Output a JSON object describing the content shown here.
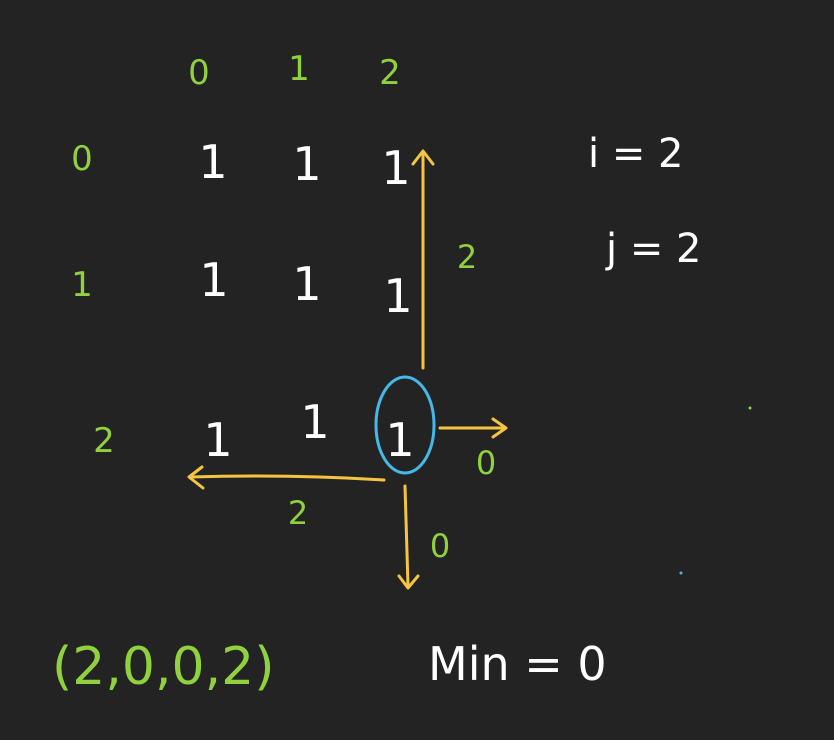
{
  "colors": {
    "background": "#232323",
    "green": "#8fd13f",
    "white": "#ffffff",
    "yellow": "#f5c542",
    "blue": "#45b8e8"
  },
  "column_indices": [
    "0",
    "1",
    "2"
  ],
  "row_indices": [
    "0",
    "1",
    "2"
  ],
  "grid_values": [
    [
      "1",
      "1",
      "1"
    ],
    [
      "1",
      "1",
      "1"
    ],
    [
      "1",
      "1",
      "1"
    ]
  ],
  "labels": {
    "up_distance": "2",
    "right_distance": "0",
    "down_distance": "0",
    "left_distance": "2",
    "i_equation": "i = 2",
    "j_equation": "j = 2",
    "tuple": "(2,0,0,2)",
    "min_label": "Min = 0"
  }
}
